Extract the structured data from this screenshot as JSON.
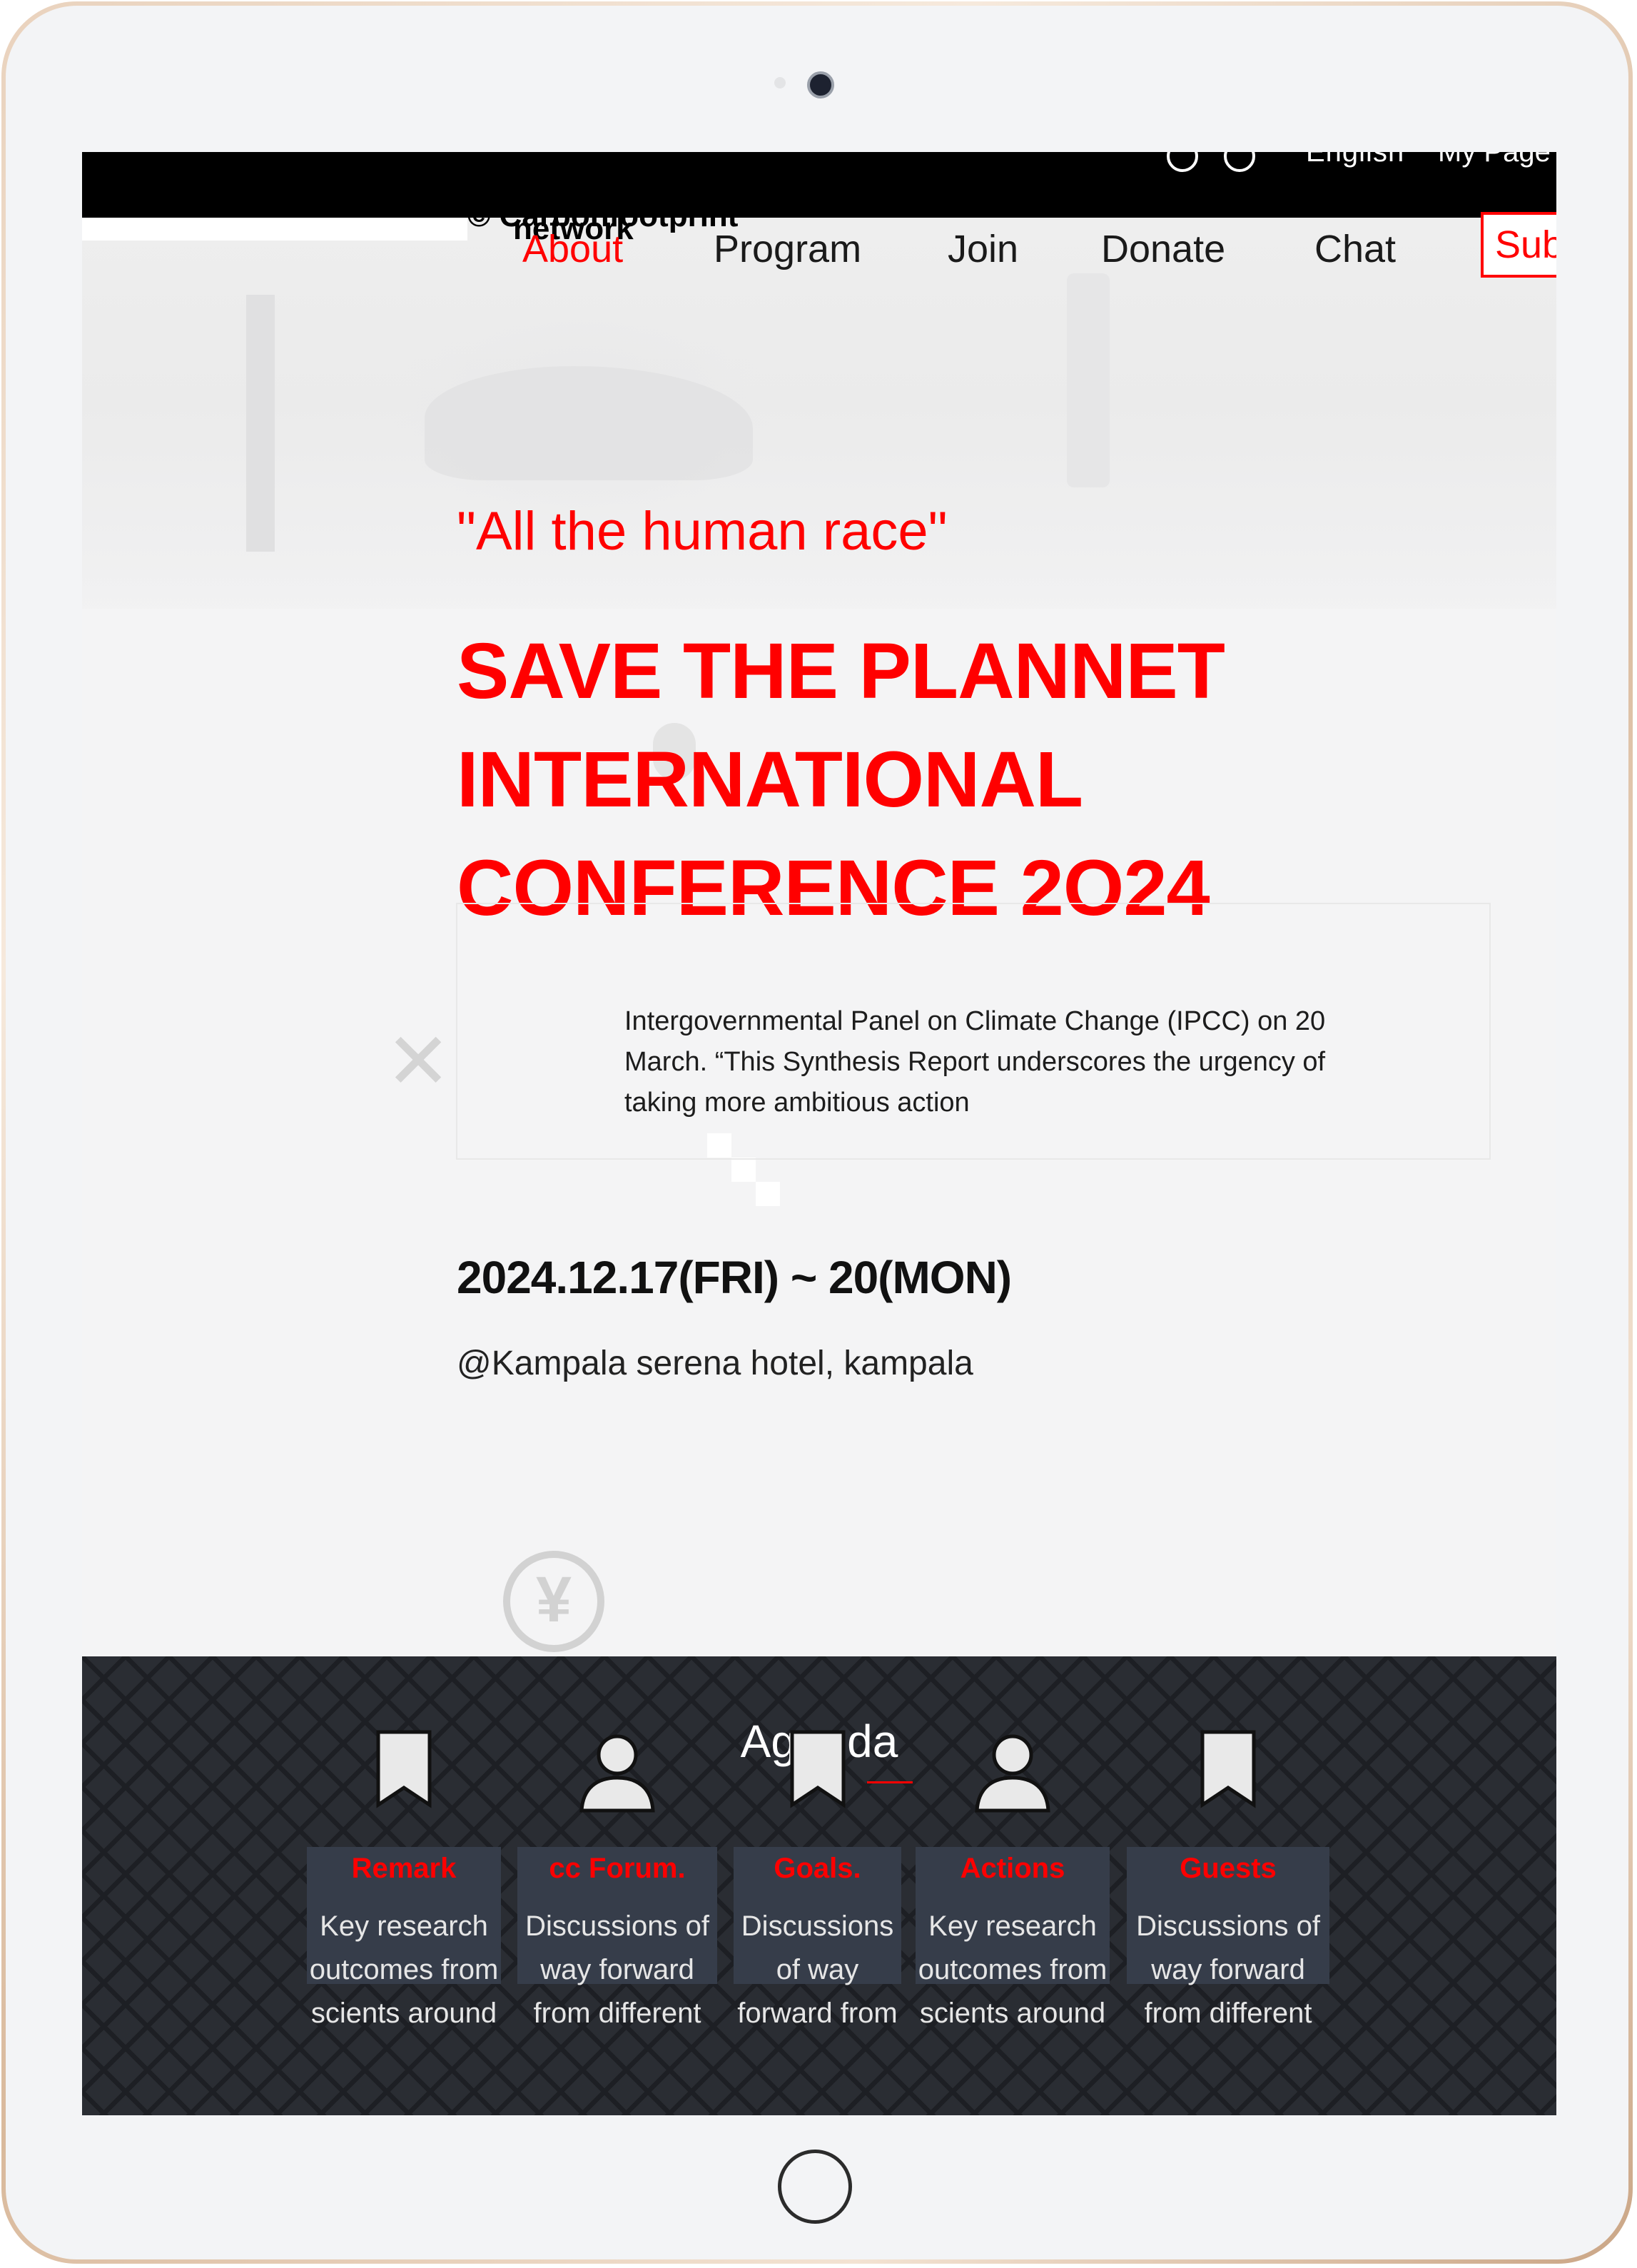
{
  "topbar": {
    "language": "English",
    "my_page": "My Page"
  },
  "logo": {
    "line1": "© Carbonfootprint",
    "line2": "network"
  },
  "nav": {
    "items": [
      {
        "label": "About",
        "active": true
      },
      {
        "label": "Program",
        "active": false
      },
      {
        "label": "Join",
        "active": false
      },
      {
        "label": "Donate",
        "active": false
      },
      {
        "label": "Chat",
        "active": false
      }
    ],
    "subscribe": "Sub"
  },
  "hero": {
    "tagline": "\"All the human race\"",
    "title_lines": [
      "SAVE THE PLANNET",
      "INTERNATIONAL",
      "CONFERENCE 2O24"
    ],
    "description": "Intergovernmental Panel on Climate Change (IPCC) on 20 March. “This Synthesis Report underscores the urgency of taking more ambitious action",
    "date": "2024.12.17(FRI) ~ 20(MON)",
    "venue": "@Kampala serena hotel, kampala"
  },
  "agenda": {
    "title": "Agenda",
    "cards": [
      {
        "icon": "bookmark-icon",
        "label": "Remark",
        "text": "Key research outcomes from scients around"
      },
      {
        "icon": "user-icon",
        "label": "cc Forum.",
        "text": "Discussions of way forward from different"
      },
      {
        "icon": "bookmark-icon",
        "label": "Goals.",
        "text": "Discussions of way forward from"
      },
      {
        "icon": "user-icon",
        "label": "Actions",
        "text": "Key research outcomes from scients around"
      },
      {
        "icon": "bookmark-icon",
        "label": "Guests",
        "text": "Discussions of way forward from different"
      }
    ]
  },
  "colors": {
    "accent": "#ff0000",
    "agenda_bg": "#2a2d33",
    "card_bg": "#363d4a"
  }
}
